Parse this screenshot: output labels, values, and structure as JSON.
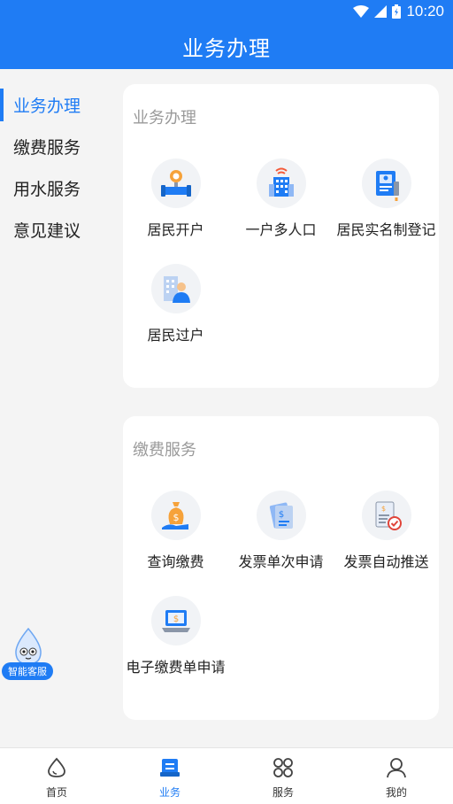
{
  "status_bar": {
    "time": "10:20"
  },
  "header": {
    "title": "业务办理"
  },
  "sidebar": {
    "items": [
      {
        "label": "业务办理",
        "active": true
      },
      {
        "label": "缴费服务",
        "active": false
      },
      {
        "label": "用水服务",
        "active": false
      },
      {
        "label": "意见建议",
        "active": false
      }
    ]
  },
  "sections": [
    {
      "title": "业务办理",
      "items": [
        {
          "label": "居民开户",
          "icon": "person-valve-icon"
        },
        {
          "label": "一户多人口",
          "icon": "building-icon"
        },
        {
          "label": "居民实名制登记",
          "icon": "id-card-icon"
        },
        {
          "label": "居民过户",
          "icon": "person-building-icon"
        }
      ]
    },
    {
      "title": "缴费服务",
      "items": [
        {
          "label": "查询缴费",
          "icon": "money-bag-icon"
        },
        {
          "label": "发票单次申请",
          "icon": "invoice-icon"
        },
        {
          "label": "发票自动推送",
          "icon": "invoice-check-icon"
        },
        {
          "label": "电子缴费单申请",
          "icon": "laptop-dollar-icon"
        }
      ]
    }
  ],
  "assistant": {
    "label": "智能客服"
  },
  "tab_bar": {
    "items": [
      {
        "label": "首页",
        "icon": "water-drop-icon",
        "active": false
      },
      {
        "label": "业务",
        "icon": "clipboard-icon",
        "active": true
      },
      {
        "label": "服务",
        "icon": "grid-icon",
        "active": false
      },
      {
        "label": "我的",
        "icon": "user-icon",
        "active": false
      }
    ]
  },
  "colors": {
    "primary": "#1f7cf4",
    "background": "#f4f4f4",
    "card": "#ffffff",
    "section_title": "#9a9a9a"
  }
}
